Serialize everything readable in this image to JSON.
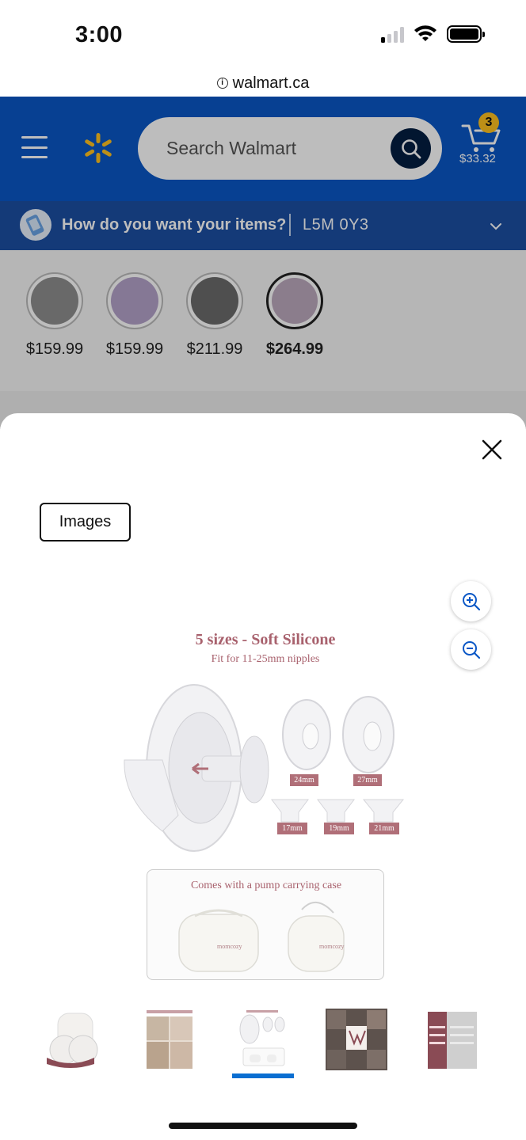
{
  "status_bar": {
    "time": "3:00"
  },
  "browser": {
    "url": "walmart.ca"
  },
  "header": {
    "search_placeholder": "Search Walmart",
    "cart_count": "3",
    "cart_total": "$33.32",
    "brand_color": "#0a57c6"
  },
  "delivery": {
    "question": "How do you want your items?",
    "postal_code": "L5M 0Y3"
  },
  "variants": [
    {
      "price": "$159.99",
      "color": "#8e8e8e",
      "selected": false
    },
    {
      "price": "$159.99",
      "color": "#b4a3c9",
      "selected": false
    },
    {
      "price": "$211.99",
      "color": "#6b6b6b",
      "selected": false
    },
    {
      "price": "$264.99",
      "color": "#bca9bd",
      "selected": true
    }
  ],
  "modal": {
    "tab_label": "Images",
    "image": {
      "title": "5 sizes - Soft Silicone",
      "subtitle": "Fit for 11-25mm nipples",
      "sizes": [
        "24mm",
        "27mm",
        "17mm",
        "19mm",
        "21mm"
      ],
      "case_caption": "Comes with a pump carrying case",
      "brand": "momcozy"
    },
    "thumbnails": [
      "product-pump",
      "lifestyle-photo",
      "sizes-image",
      "collage-image",
      "comparison-chart"
    ],
    "selected_thumbnail": 2
  }
}
